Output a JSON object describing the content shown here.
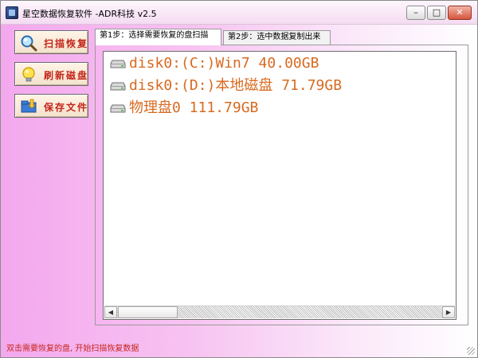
{
  "window": {
    "title": "星空数据恢复软件   -ADR科技 v2.5",
    "controls": {
      "minimize": "–",
      "maximize": "□",
      "close": "✕"
    }
  },
  "sidebar": {
    "buttons": [
      {
        "label": "扫描恢复",
        "icon": "magnifier-icon"
      },
      {
        "label": "刷新磁盘",
        "icon": "lightbulb-icon"
      },
      {
        "label": "保存文件",
        "icon": "save-folder-icon"
      }
    ]
  },
  "tabs": [
    {
      "label": "第1步：选择需要恢复的盘扫描",
      "active": true
    },
    {
      "label": "第2步：选中数据复制出来",
      "active": false
    }
  ],
  "disk_list": [
    {
      "text": "disk0:(C:)Win7 40.00GB",
      "icon": "hard-disk-icon"
    },
    {
      "text": "disk0:(D:)本地磁盘 71.79GB",
      "icon": "hard-disk-icon"
    },
    {
      "text": "物理盘0 111.79GB",
      "icon": "hard-disk-icon"
    }
  ],
  "scrollbar": {
    "left_arrow": "◀",
    "right_arrow": "▶"
  },
  "status": {
    "text": "双击需要恢复的盘, 开始扫描恢复数据"
  },
  "colors": {
    "accent_red": "#c4261b",
    "disk_text": "#d86a20",
    "background_pink": "#f4a8ee"
  }
}
